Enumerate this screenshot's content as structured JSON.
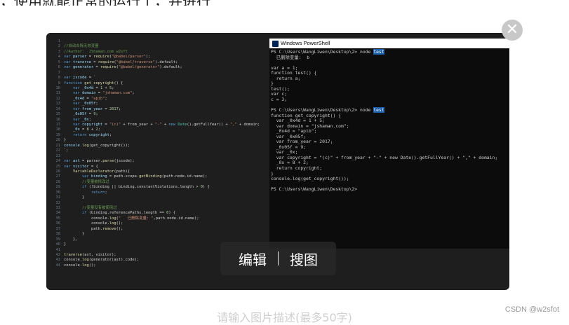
{
  "top_text": "，使用就能正常的运行了，并进行",
  "editor_lines": [
    {
      "n": "1",
      "t": [
        [
          "",
          ""
        ]
      ]
    },
    {
      "n": "2",
      "t": [
        [
          "cm",
          "//自动去除无效变量"
        ]
      ]
    },
    {
      "n": "3",
      "t": [
        [
          "cm",
          "//Author:  JShaman.com w2sft"
        ]
      ]
    },
    {
      "n": "4",
      "t": [
        [
          "kw",
          "var "
        ],
        [
          "var",
          "parser"
        ],
        [
          "code",
          " = "
        ],
        [
          "fn",
          "require"
        ],
        [
          "code",
          "("
        ],
        [
          "str",
          "\"@babel/parser\""
        ],
        [
          "code",
          ");"
        ]
      ]
    },
    {
      "n": "5",
      "t": [
        [
          "kw",
          "var "
        ],
        [
          "var",
          "traverse"
        ],
        [
          "code",
          " = "
        ],
        [
          "fn",
          "require"
        ],
        [
          "code",
          "("
        ],
        [
          "str",
          "\"@babel/traverse\""
        ],
        [
          "code",
          ").default;"
        ]
      ]
    },
    {
      "n": "6",
      "t": [
        [
          "kw",
          "var "
        ],
        [
          "var",
          "generator"
        ],
        [
          "code",
          " = "
        ],
        [
          "fn",
          "require"
        ],
        [
          "code",
          "("
        ],
        [
          "str",
          "\"@babel/generator\""
        ],
        [
          "code",
          ").default;"
        ]
      ]
    },
    {
      "n": "7",
      "t": [
        [
          "",
          ""
        ]
      ]
    },
    {
      "n": "8",
      "t": [
        [
          "kw",
          "var "
        ],
        [
          "var",
          "jscode"
        ],
        [
          "code",
          " = `"
        ]
      ]
    },
    {
      "n": "9",
      "t": [
        [
          "kw",
          "function "
        ],
        [
          "fn",
          "get_copyright"
        ],
        [
          "code",
          "() {"
        ]
      ]
    },
    {
      "n": "10",
      "t": [
        [
          "code",
          "    "
        ],
        [
          "kw",
          "var "
        ],
        [
          "var",
          "_0x4d"
        ],
        [
          "code",
          " = "
        ],
        [
          "num",
          "1"
        ],
        [
          "code",
          " + "
        ],
        [
          "num",
          "5"
        ],
        [
          "code",
          ";"
        ]
      ]
    },
    {
      "n": "11",
      "t": [
        [
          "code",
          "    "
        ],
        [
          "kw",
          "var "
        ],
        [
          "var",
          "domain"
        ],
        [
          "code",
          " = "
        ],
        [
          "str",
          "\"jshaman.com\""
        ],
        [
          "code",
          ";"
        ]
      ]
    },
    {
      "n": "12",
      "t": [
        [
          "code",
          "    "
        ],
        [
          "var",
          "_0x4d"
        ],
        [
          "code",
          " = "
        ],
        [
          "str",
          "\"apib\""
        ],
        [
          "code",
          ";"
        ]
      ]
    },
    {
      "n": "13",
      "t": [
        [
          "code",
          "    "
        ],
        [
          "kw",
          "var "
        ],
        [
          "var",
          "_0x05f"
        ],
        [
          "code",
          ";"
        ]
      ]
    },
    {
      "n": "14",
      "t": [
        [
          "code",
          "    "
        ],
        [
          "kw",
          "var "
        ],
        [
          "var",
          "from_year"
        ],
        [
          "code",
          " = "
        ],
        [
          "num",
          "2017"
        ],
        [
          "code",
          ";"
        ]
      ]
    },
    {
      "n": "15",
      "t": [
        [
          "code",
          "    "
        ],
        [
          "var",
          "_0x05f"
        ],
        [
          "code",
          " = "
        ],
        [
          "num",
          "9"
        ],
        [
          "code",
          ";"
        ]
      ]
    },
    {
      "n": "16",
      "t": [
        [
          "code",
          "    "
        ],
        [
          "kw",
          "var "
        ],
        [
          "var",
          "_0x"
        ],
        [
          "code",
          ";"
        ]
      ]
    },
    {
      "n": "17",
      "t": [
        [
          "code",
          "    "
        ],
        [
          "kw",
          "var "
        ],
        [
          "var",
          "copyright"
        ],
        [
          "code",
          " = "
        ],
        [
          "str",
          "\"(c)\""
        ],
        [
          "code",
          " + from_year + "
        ],
        [
          "str",
          "\"-\""
        ],
        [
          "code",
          " + "
        ],
        [
          "kw",
          "new "
        ],
        [
          "cls",
          "Date"
        ],
        [
          "code",
          "().getFullYear() + "
        ],
        [
          "str",
          "\",\""
        ],
        [
          "code",
          " + domain;"
        ]
      ]
    },
    {
      "n": "18",
      "t": [
        [
          "code",
          "    "
        ],
        [
          "var",
          "_0x"
        ],
        [
          "code",
          " = "
        ],
        [
          "num",
          "8"
        ],
        [
          "code",
          " + "
        ],
        [
          "num",
          "2"
        ],
        [
          "code",
          ";"
        ]
      ]
    },
    {
      "n": "19",
      "t": [
        [
          "code",
          "    "
        ],
        [
          "kw",
          "return "
        ],
        [
          "var",
          "copyright"
        ],
        [
          "code",
          ";"
        ]
      ]
    },
    {
      "n": "20",
      "t": [
        [
          "code",
          "}"
        ]
      ]
    },
    {
      "n": "21",
      "t": [
        [
          "var",
          "console"
        ],
        [
          "code",
          "."
        ],
        [
          "fn",
          "log"
        ],
        [
          "code",
          "(get_copyright());"
        ]
      ]
    },
    {
      "n": "22",
      "t": [
        [
          "code",
          "`;"
        ]
      ]
    },
    {
      "n": "23",
      "t": [
        [
          "",
          ""
        ]
      ]
    },
    {
      "n": "24",
      "t": [
        [
          "kw",
          "var "
        ],
        [
          "var",
          "ast"
        ],
        [
          "code",
          " = parser."
        ],
        [
          "fn",
          "parse"
        ],
        [
          "code",
          "(jscode);"
        ]
      ]
    },
    {
      "n": "25",
      "t": [
        [
          "kw",
          "var "
        ],
        [
          "var",
          "visitor"
        ],
        [
          "code",
          " = {"
        ]
      ]
    },
    {
      "n": "26",
      "t": [
        [
          "code",
          "    "
        ],
        [
          "fn",
          "VariableDeclarator"
        ],
        [
          "code",
          "(path){"
        ]
      ]
    },
    {
      "n": "27",
      "t": [
        [
          "code",
          "        "
        ],
        [
          "kw",
          "var "
        ],
        [
          "var",
          "binding"
        ],
        [
          "code",
          " = path.scope."
        ],
        [
          "fn",
          "getBinding"
        ],
        [
          "code",
          "(path.node.id.name);"
        ]
      ]
    },
    {
      "n": "28",
      "t": [
        [
          "code",
          "        "
        ],
        [
          "cm",
          "//变量被修改过"
        ]
      ]
    },
    {
      "n": "29",
      "t": [
        [
          "code",
          "        "
        ],
        [
          "kw",
          "if "
        ],
        [
          "code",
          "(!binding || binding.constantViolations.length > "
        ],
        [
          "num",
          "0"
        ],
        [
          "code",
          ") {"
        ]
      ]
    },
    {
      "n": "30",
      "t": [
        [
          "code",
          "            "
        ],
        [
          "kw",
          "return"
        ],
        [
          "code",
          ";"
        ]
      ]
    },
    {
      "n": "31",
      "t": [
        [
          "code",
          "        }"
        ]
      ]
    },
    {
      "n": "32",
      "t": [
        [
          "",
          ""
        ]
      ]
    },
    {
      "n": "33",
      "t": [
        [
          "code",
          "        "
        ],
        [
          "cm",
          "//变量没有被使用过"
        ]
      ]
    },
    {
      "n": "34",
      "t": [
        [
          "code",
          "        "
        ],
        [
          "kw",
          "if "
        ],
        [
          "code",
          "(binding.referencePaths.length == "
        ],
        [
          "num",
          "0"
        ],
        [
          "code",
          ") {"
        ]
      ]
    },
    {
      "n": "35",
      "t": [
        [
          "code",
          "            console."
        ],
        [
          "fn",
          "log"
        ],
        [
          "code",
          "("
        ],
        [
          "str",
          "\"   已删除变量: \""
        ],
        [
          "code",
          ",path.node.id.name);"
        ]
      ]
    },
    {
      "n": "36",
      "t": [
        [
          "code",
          "            console."
        ],
        [
          "fn",
          "log"
        ],
        [
          "code",
          "();"
        ]
      ]
    },
    {
      "n": "37",
      "t": [
        [
          "code",
          "            path."
        ],
        [
          "fn",
          "remove"
        ],
        [
          "code",
          "();"
        ]
      ]
    },
    {
      "n": "38",
      "t": [
        [
          "code",
          "        }"
        ]
      ]
    },
    {
      "n": "39",
      "t": [
        [
          "code",
          "    },"
        ]
      ]
    },
    {
      "n": "40",
      "t": [
        [
          "code",
          "}"
        ]
      ]
    },
    {
      "n": "41",
      "t": [
        [
          "",
          ""
        ]
      ]
    },
    {
      "n": "42",
      "t": [
        [
          "fn",
          "traverse"
        ],
        [
          "code",
          "(ast, visitor);"
        ]
      ]
    },
    {
      "n": "43",
      "t": [
        [
          "code",
          "console."
        ],
        [
          "fn",
          "log"
        ],
        [
          "code",
          "(generator(ast).code);"
        ]
      ]
    },
    {
      "n": "44",
      "t": [
        [
          "code",
          "console."
        ],
        [
          "fn",
          "log"
        ],
        [
          "code",
          "();"
        ]
      ]
    }
  ],
  "ps_title": "Windows PowerShell",
  "ps_lines": [
    {
      "pre": "PS C:\\Users\\WangLiwen\\Desktop\\2> node ",
      "hl": "test"
    },
    {
      "pre": "  已删除变量:  b"
    },
    {
      "pre": ""
    },
    {
      "pre": "var a = 1;"
    },
    {
      "pre": "function test() {"
    },
    {
      "pre": "  return a;"
    },
    {
      "pre": "}"
    },
    {
      "pre": "test();"
    },
    {
      "pre": "var c;"
    },
    {
      "pre": "c = 3;"
    },
    {
      "pre": ""
    },
    {
      "pre": "PS C:\\Users\\WangLiwen\\Desktop\\2> node ",
      "hl": "test"
    },
    {
      "pre": "function get_copyright() {"
    },
    {
      "pre": "  var _0x4d = 1 + 5;"
    },
    {
      "pre": "  var domain = \"jshaman.com\";"
    },
    {
      "pre": "  _0x4d = \"apib\";"
    },
    {
      "pre": "  var _0x05f;"
    },
    {
      "pre": "  var from_year = 2017;"
    },
    {
      "pre": "  _0x05f = 9;"
    },
    {
      "pre": "  var _0x;"
    },
    {
      "pre": "  var copyright = \"(c)\" + from_year + \"-\" + new Date().getFullYear() + \",\" + domain;"
    },
    {
      "pre": "  _0x = 8 + 2;"
    },
    {
      "pre": "  return copyright;"
    },
    {
      "pre": "}"
    },
    {
      "pre": "console.log(get_copyright());"
    },
    {
      "pre": ""
    },
    {
      "pre": "PS C:\\Users\\WangLiwen\\Desktop\\2> "
    }
  ],
  "actions": {
    "edit": "编辑",
    "search_image": "搜图"
  },
  "close_symbol": "✕",
  "caption_placeholder": "请输入图片描述(最多50字)",
  "watermark": "CSDN @w2sfot"
}
